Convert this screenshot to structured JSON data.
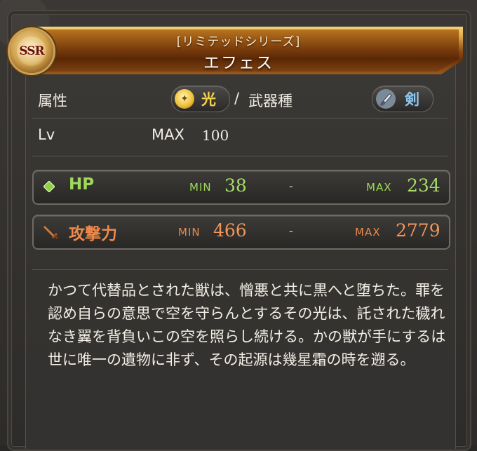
{
  "header": {
    "series": "[リミテッドシリーズ]",
    "name": "エフェス",
    "rarity": "SSR"
  },
  "attributes": {
    "element_label": "属性",
    "element_value": "光",
    "separator": "/",
    "weapon_type_label": "武器種",
    "weapon_type_value": "剣",
    "element_icon": "light-orb-icon",
    "weapon_icon": "sword-icon"
  },
  "level": {
    "label": "Lv",
    "max_label": "MAX",
    "max_value": "100"
  },
  "stats": {
    "hp": {
      "label": "HP",
      "min_label": "MIN",
      "min_value": "38",
      "dash": "-",
      "max_label": "MAX",
      "max_value": "234",
      "icon": "hp-diamond-icon",
      "color": "#9fd85a"
    },
    "atk": {
      "label": "攻撃力",
      "min_label": "MIN",
      "min_value": "466",
      "dash": "-",
      "max_label": "MAX",
      "max_value": "2779",
      "icon": "attack-sword-icon",
      "color": "#ef8a4a"
    }
  },
  "description": "かつて代替品とされた獣は、憎悪と共に黒へと堕ちた。罪を認め自らの意思で空を守らんとするその光は、託された穢れなき翼を背負いこの空を照らし続ける。かの獣が手にするは世に唯一の遺物に非ず、その起源は幾星霜の時を遡る。"
}
